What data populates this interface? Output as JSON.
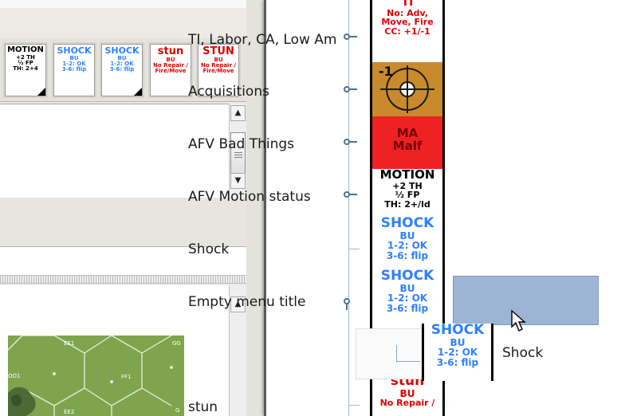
{
  "palette": {
    "selection": "#9db4d5",
    "counter_blue": "#2d80ff",
    "counter_red": "#e00000",
    "acquisition_orange": "#c98a2c",
    "malf_red": "#ee2222",
    "tree_line": "#4d7191"
  },
  "toolbar": {
    "counters": [
      {
        "id": "motion",
        "color": "black",
        "line1": "MOTION",
        "line2": "+2 TH",
        "line3": "½ FP",
        "line4": "TH: 2+4"
      },
      {
        "id": "shock1",
        "color": "blue",
        "line1": "SHOCK",
        "line2": "BU",
        "line3": "1-2: OK",
        "line4": "3-6: flip"
      },
      {
        "id": "shock2",
        "color": "blue",
        "line1": "SHOCK",
        "line2": "BU",
        "line3": "1-2: OK",
        "line4": "3-6: flip"
      },
      {
        "id": "stun1",
        "color": "red",
        "line1": "stun",
        "line2": "BU",
        "line3": "No Repair /",
        "line4": "Fire/Move"
      },
      {
        "id": "stun2",
        "color": "red",
        "line1": "STUN",
        "line2": "BU",
        "line3": "No Repair /",
        "line4": "Fire/Move"
      }
    ]
  },
  "map": {
    "hex_labels": [
      "EE1",
      "FF1",
      "GG",
      "G",
      "OO1",
      "EE2"
    ]
  },
  "menu": {
    "items": [
      {
        "label": "TI, Labor, CA, Low Am",
        "counter": {
          "l1": "No: Adv,",
          "l2": "Move, Fire",
          "l3": "CC: +1/-1"
        }
      },
      {
        "label": "Acquisitions",
        "counter": {
          "l1": "-1"
        }
      },
      {
        "label": "AFV Bad Things",
        "counter": {
          "l1": "MA",
          "l2": "Malf"
        }
      },
      {
        "label": "AFV Motion status",
        "counter": {
          "l1": "MOTION",
          "l2": "+2 TH",
          "l3": "½ FP",
          "l4": "TH: 2+/ld"
        }
      },
      {
        "label": "Shock",
        "counter": {
          "l1": "SHOCK",
          "l2": "BU",
          "l3": "1-2: OK",
          "l4": "3-6: flip"
        }
      },
      {
        "label": "Empty menu title",
        "counter": {
          "l1": "SHOCK",
          "l2": "BU",
          "l3": "1-2: OK",
          "l4": "3-6: flip"
        }
      },
      {
        "label": "stun",
        "counter": {
          "l1": "stun",
          "l2": "BU",
          "l3": "No Repair /"
        }
      }
    ],
    "dragging": {
      "label": "Shock",
      "l1": "SHOCK",
      "l2": "BU",
      "l3": "1-2: OK",
      "l4": "3-6: flip"
    }
  }
}
